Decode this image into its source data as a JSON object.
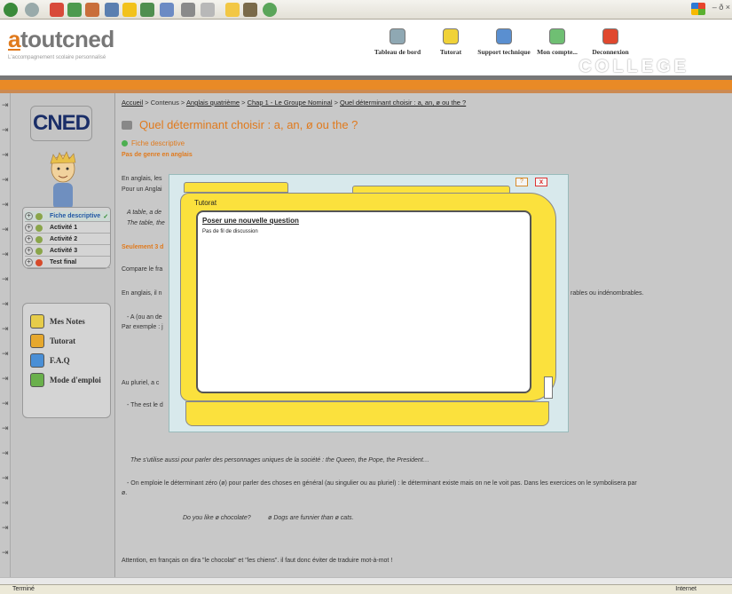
{
  "browser": {
    "window_controls": "– ð ×",
    "status_left": "Terminé",
    "status_right": "Internet"
  },
  "site": {
    "logo_prefix": "a",
    "logo_rest": "toutcned",
    "tagline": "L'accompagnement scolaire personnalisé",
    "college": "COLLEGE",
    "nav": [
      {
        "label": "Tableau de bord",
        "icon": "dashboard-icon",
        "color": "#8fa8b3"
      },
      {
        "label": "Tutorat",
        "icon": "tutorat-icon",
        "color": "#f0d238"
      },
      {
        "label": "Support technique",
        "icon": "support-icon",
        "color": "#5a8fd0"
      },
      {
        "label": "Mon compte...",
        "icon": "account-icon",
        "color": "#6fbf73"
      },
      {
        "label": "Deconnexion",
        "icon": "power-icon",
        "color": "#e0482e"
      }
    ]
  },
  "sidebar": {
    "cned_logo": "CNED",
    "activities": [
      {
        "label": "Fiche descriptive",
        "check": "✓",
        "current": true
      },
      {
        "label": "Activité 1",
        "current": false
      },
      {
        "label": "Activité 2",
        "current": false
      },
      {
        "label": "Activité 3",
        "current": false
      },
      {
        "label": "Test final",
        "current": false
      }
    ],
    "tools": [
      {
        "label": "Mes Notes",
        "icon": "notes-icon",
        "color": "#e6cc4a"
      },
      {
        "label": "Tutorat",
        "icon": "tutorat-icon",
        "color": "#e6a82e"
      },
      {
        "label": "F.A.Q",
        "icon": "faq-icon",
        "color": "#4a8fd6"
      },
      {
        "label": "Mode d'emploi",
        "icon": "manual-icon",
        "color": "#6ab04c"
      }
    ]
  },
  "content": {
    "breadcrumb": {
      "home": "Accueil",
      "sep1": " > Contenus > ",
      "level": "Anglais quatrième",
      "sep2": " > ",
      "chapter": "Chap 1 - Le Groupe Nominal",
      "sep3": " > ",
      "lesson": "Quel déterminant choisir : a, an, ø ou the ?"
    },
    "title": "Quel déterminant choisir : a, an, ø ou the ?",
    "fiche_label": "Fiche descriptive",
    "subhead": "Pas de genre en anglais",
    "p1": "En anglais, les",
    "p2": "Pour un Anglai",
    "ex1": "A table, a de",
    "ex2": "The table, the",
    "seul": "Seulement 3 d",
    "compare": "Compare le fra",
    "p_en_anglais": "En anglais, il n",
    "p_denombrables": "rables ou indénombrables.",
    "a_item": "- A (ou an de",
    "par_exemple": "Par exemple : j",
    "au_pluriel": "Au pluriel, a c",
    "the_item": "- The est le d",
    "the_unique": "The s'utilise aussi pour parler des personnages uniques de la société : the Queen, the Pope, the President…",
    "zero_det": "- On emploie le déterminant zéro (ø) pour parler des choses en général (au singulier ou au pluriel) : le déterminant existe mais on ne le voit pas. Dans les exercices on le symbolisera par",
    "zero_det_2": "ø.",
    "examples_line": "Do you like ø chocolate?          ø Dogs are funnier than ø cats.",
    "attention": "Attention, en français on dira \"le chocolat\" et \"les chiens\". il faut donc éviter de traduire mot-à-mot !"
  },
  "modal": {
    "title": "Tutorat",
    "ask_link": "Poser une nouvelle question",
    "no_thread": "Pas de fil de discussion",
    "close": "x",
    "help": "?"
  }
}
